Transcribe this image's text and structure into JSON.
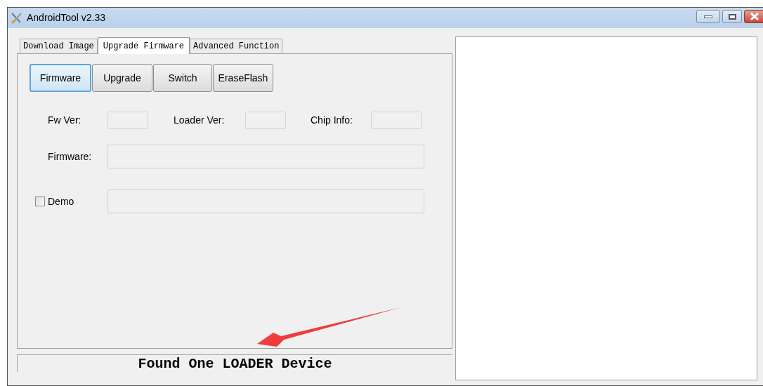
{
  "window": {
    "title": "AndroidTool v2.33"
  },
  "tabs": [
    {
      "label": "Download Image",
      "selected": false
    },
    {
      "label": "Upgrade Firmware",
      "selected": true
    },
    {
      "label": "Advanced Function",
      "selected": false
    }
  ],
  "buttons": [
    {
      "label": "Firmware",
      "focused": true
    },
    {
      "label": "Upgrade",
      "focused": false
    },
    {
      "label": "Switch",
      "focused": false
    },
    {
      "label": "EraseFlash",
      "focused": false
    }
  ],
  "info_fields": [
    {
      "label": "Fw Ver:"
    },
    {
      "label": "Loader Ver:"
    },
    {
      "label": "Chip Info:"
    }
  ],
  "firmware_field": {
    "label": "Firmware:"
  },
  "demo": {
    "label": "Demo",
    "checked": false
  },
  "status": "Found One LOADER Device"
}
